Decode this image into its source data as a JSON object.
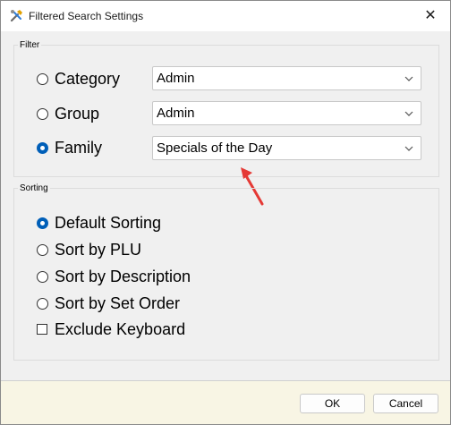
{
  "window": {
    "title": "Filtered Search Settings",
    "close_glyph": "✕"
  },
  "filter": {
    "legend": "Filter",
    "options": [
      {
        "label": "Category",
        "selected": false,
        "value": "Admin"
      },
      {
        "label": "Group",
        "selected": false,
        "value": "Admin"
      },
      {
        "label": "Family",
        "selected": true,
        "value": "Specials of the Day"
      }
    ]
  },
  "sorting": {
    "legend": "Sorting",
    "options": [
      {
        "label": "Default Sorting",
        "selected": true
      },
      {
        "label": "Sort by PLU",
        "selected": false
      },
      {
        "label": "Sort by Description",
        "selected": false
      },
      {
        "label": "Sort by Set Order",
        "selected": false
      }
    ],
    "exclude_keyboard": {
      "label": "Exclude Keyboard",
      "checked": false
    }
  },
  "buttons": {
    "ok": "OK",
    "cancel": "Cancel"
  },
  "colors": {
    "accent": "#005fb8",
    "annotation": "#e53935",
    "footer": "#f8f5e4"
  },
  "icons": {
    "app": "tools-icon",
    "combo": "chevron-down-icon",
    "annotation": "red-arrow-icon"
  }
}
